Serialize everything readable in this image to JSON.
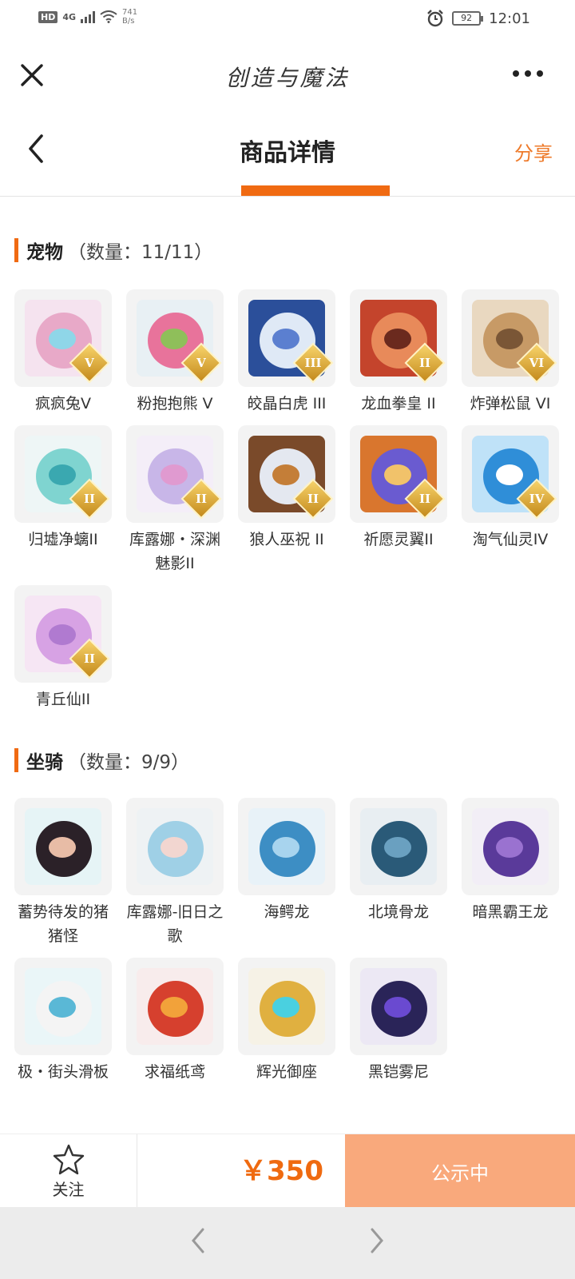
{
  "status_bar": {
    "hd": "HD",
    "network": "4G",
    "speed_value": "741",
    "speed_unit": "B/s",
    "battery": "92",
    "time": "12:01"
  },
  "app_bar": {
    "title": "创造与魔法"
  },
  "header": {
    "title": "商品详情",
    "share_label": "分享"
  },
  "pets": {
    "name": "宠物",
    "count": "（数量：11/11）",
    "items": [
      {
        "label": "疯疯兔V",
        "badge": "V",
        "colors": [
          "#f5e3ef",
          "#e8a9c8",
          "#8fd6e8"
        ]
      },
      {
        "label": "粉抱抱熊 V",
        "badge": "V",
        "colors": [
          "#e8f0f4",
          "#e8739b",
          "#8fbf5a"
        ]
      },
      {
        "label": "皎晶白虎 III",
        "badge": "III",
        "colors": [
          "#2b4f9a",
          "#dfe9f6",
          "#5b7fd0"
        ]
      },
      {
        "label": "龙血拳皇 II",
        "badge": "II",
        "colors": [
          "#c4442c",
          "#e88a5a",
          "#6b2a1e"
        ]
      },
      {
        "label": "炸弹松鼠 VI",
        "badge": "VI",
        "colors": [
          "#e9d8c0",
          "#c79a66",
          "#7a5636"
        ]
      },
      {
        "label": "归墟净螭II",
        "badge": "II",
        "colors": [
          "#eef6f6",
          "#7fd4d0",
          "#3aa8b0"
        ]
      },
      {
        "label": "库露娜・深渊魅影II",
        "badge": "II",
        "colors": [
          "#f4eef8",
          "#c8b6e8",
          "#e09ad0"
        ]
      },
      {
        "label": "狼人巫祝 II",
        "badge": "II",
        "colors": [
          "#7a4a2a",
          "#e4e8f0",
          "#c47e38"
        ]
      },
      {
        "label": "祈愿灵翼II",
        "badge": "II",
        "colors": [
          "#d9762e",
          "#6a5bd0",
          "#f1c26a"
        ]
      },
      {
        "label": "淘气仙灵IV",
        "badge": "IV",
        "colors": [
          "#bfe2f8",
          "#2f8ed8",
          "#ffffff"
        ]
      },
      {
        "label": "青丘仙II",
        "badge": "II",
        "colors": [
          "#f6e6f4",
          "#d7a2e4",
          "#b07ad0"
        ]
      }
    ]
  },
  "mounts": {
    "name": "坐骑",
    "count": "（数量：9/9）",
    "items": [
      {
        "label": "蓄势待发的猪猪怪",
        "colors": [
          "#e6f4f6",
          "#2b2128",
          "#e8bca6"
        ]
      },
      {
        "label": "库露娜-旧日之歌",
        "colors": [
          "#eef2f4",
          "#9fd0e6",
          "#f2d6d0"
        ]
      },
      {
        "label": "海鳄龙",
        "colors": [
          "#e8f2f8",
          "#3d8ec4",
          "#a8d4ee"
        ]
      },
      {
        "label": "北境骨龙",
        "colors": [
          "#e8eef2",
          "#2a5a78",
          "#6aa0c0"
        ]
      },
      {
        "label": "暗黑霸王龙",
        "colors": [
          "#f2eef6",
          "#5a3a9a",
          "#9a72d0"
        ]
      },
      {
        "label": "极・街头滑板",
        "colors": [
          "#eaf6f8",
          "#f4f4f4",
          "#5ab8d6"
        ]
      },
      {
        "label": "求福纸鸢",
        "colors": [
          "#f8ecec",
          "#d6402e",
          "#f2a23a"
        ]
      },
      {
        "label": "辉光御座",
        "colors": [
          "#f6f2e6",
          "#e0b040",
          "#4ad0e0"
        ]
      },
      {
        "label": "黑铠雾尼",
        "colors": [
          "#ece8f4",
          "#2a2458",
          "#6a4ad0"
        ]
      }
    ]
  },
  "bottom": {
    "follow_label": "关注",
    "price": "￥350",
    "status_label": "公示中"
  },
  "theme": {
    "accent": "#f06a12",
    "price_color": "#ef6a10",
    "status_button": "#f9a97c"
  }
}
